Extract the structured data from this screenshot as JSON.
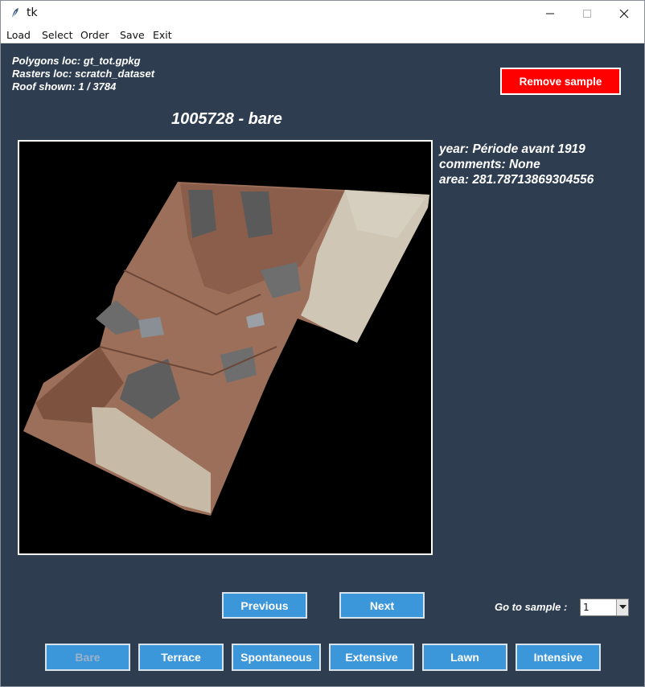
{
  "window": {
    "title": "tk"
  },
  "menu": [
    "Load",
    "Select",
    "Order",
    "Save",
    "Exit"
  ],
  "info": {
    "polygons": "Polygons loc: gt_tot.gpkg",
    "rasters": "Rasters loc: scratch_dataset",
    "roof": "Roof shown: 1 / 3784"
  },
  "remove_label": "Remove sample",
  "sample": {
    "title": "1005728 - bare",
    "year": "year: Période avant 1919",
    "comments": "comments: None",
    "area": "area: 281.78713869304556"
  },
  "nav": {
    "previous": "Previous",
    "next": "Next"
  },
  "goto": {
    "label": "Go to sample :",
    "value": "1"
  },
  "classes": [
    "Bare",
    "Terrace",
    "Spontaneous",
    "Extensive",
    "Lawn",
    "Intensive"
  ],
  "colors": {
    "background": "#2e3e50",
    "button": "#3b96da",
    "remove": "#ff0000"
  },
  "icons": [
    "feather-icon",
    "minimize-icon",
    "maximize-icon",
    "close-icon",
    "chevron-down-icon"
  ]
}
